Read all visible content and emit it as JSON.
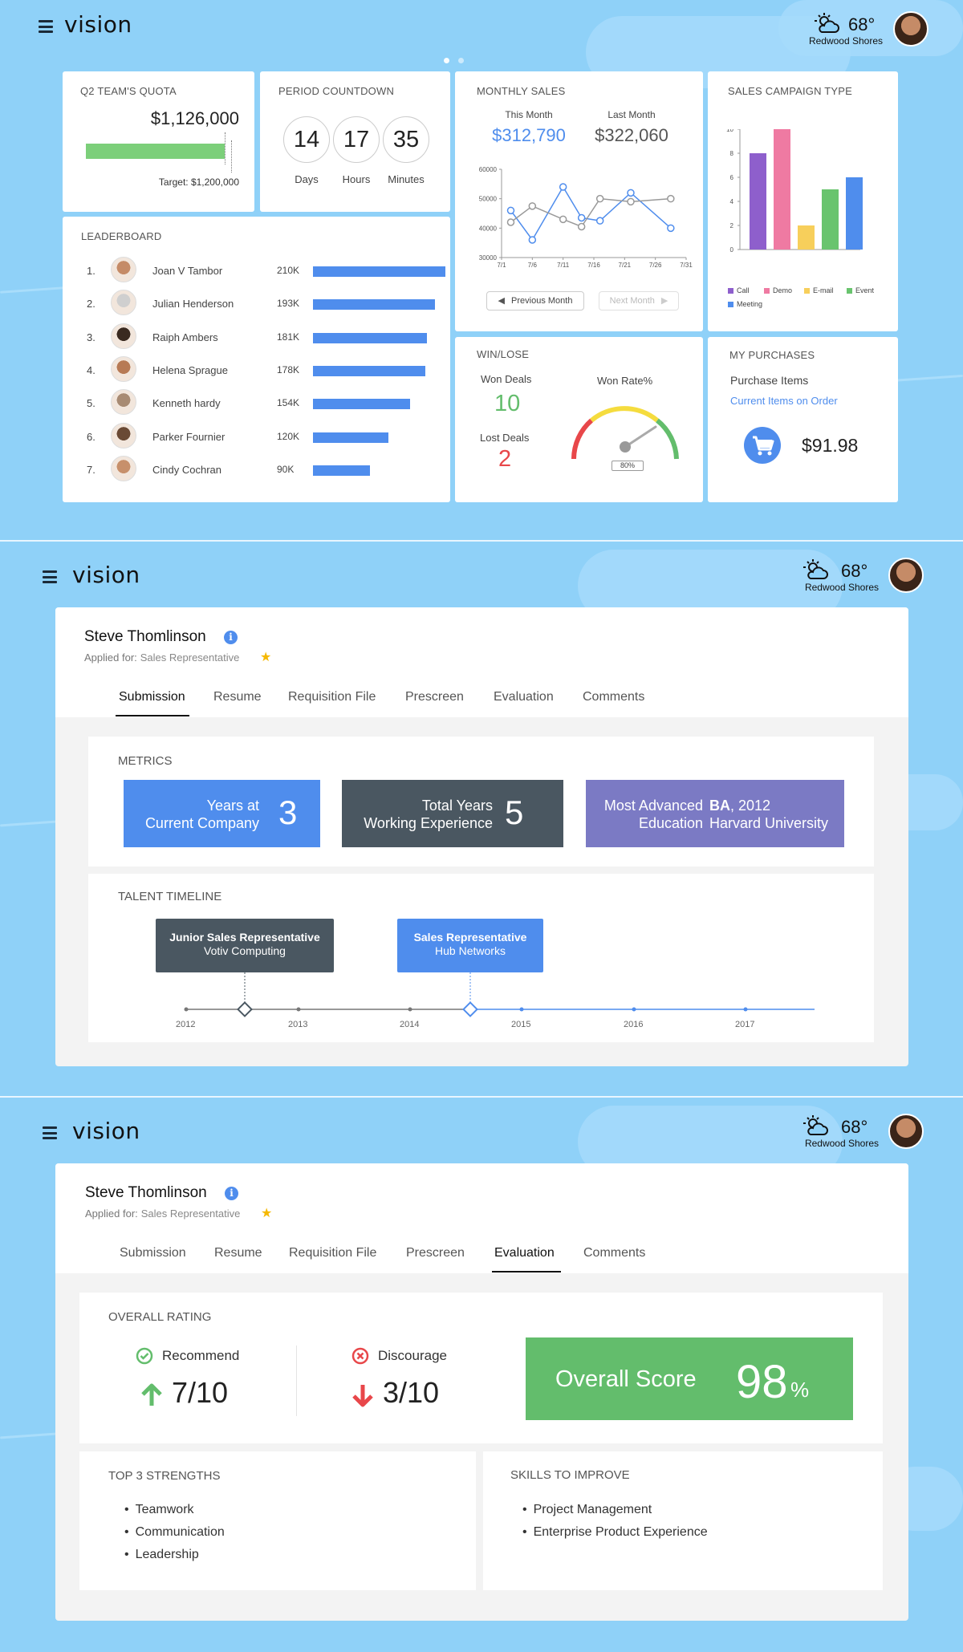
{
  "app": {
    "logo": "vision",
    "weather": {
      "temp": "68°",
      "city": "Redwood Shores",
      "icon": "partly-cloudy-icon"
    }
  },
  "dashboard": {
    "quota": {
      "title": "Q2 TEAM'S QUOTA",
      "amount": "$1,126,000",
      "target": "Target: $1,200,000",
      "progress": 0.94
    },
    "countdown": {
      "title": "PERIOD COUNTDOWN",
      "items": [
        {
          "value": "14",
          "label": "Days"
        },
        {
          "value": "17",
          "label": "Hours"
        },
        {
          "value": "35",
          "label": "Minutes"
        }
      ]
    },
    "monthly_sales": {
      "title": "MONTHLY SALES",
      "this_month_label": "This Month",
      "this_month_value": "$312,790",
      "last_month_label": "Last Month",
      "last_month_value": "$322,060",
      "prev_button": "Previous Month",
      "next_button": "Next Month"
    },
    "campaign": {
      "title": "SALES CAMPAIGN TYPE"
    },
    "leaderboard": {
      "title": "LEADERBOARD",
      "rows": [
        {
          "rank": "1.",
          "name": "Joan V Tambor",
          "value": "210K",
          "amount": 210
        },
        {
          "rank": "2.",
          "name": "Julian Henderson",
          "value": "193K",
          "amount": 193
        },
        {
          "rank": "3.",
          "name": "Raiph Ambers",
          "value": "181K",
          "amount": 181
        },
        {
          "rank": "4.",
          "name": "Helena Sprague",
          "value": "178K",
          "amount": 178
        },
        {
          "rank": "5.",
          "name": "Kenneth hardy",
          "value": "154K",
          "amount": 154
        },
        {
          "rank": "6.",
          "name": "Parker Fournier",
          "value": "120K",
          "amount": 120
        },
        {
          "rank": "7.",
          "name": "Cindy Cochran",
          "value": "90K",
          "amount": 90
        }
      ]
    },
    "winlose": {
      "title": "WIN/LOSE",
      "won_label": "Won Deals",
      "won_value": "10",
      "lost_label": "Lost Deals",
      "lost_value": "2",
      "rate_label": "Won Rate%",
      "rate_value": "80%"
    },
    "purchases": {
      "title": "MY PURCHASES",
      "items_label": "Purchase Items",
      "link": "Current Items on Order",
      "total": "$91.98"
    }
  },
  "profile": {
    "name": "Steve Thomlinson",
    "applied_label": "Applied for:",
    "applied_role": "Sales Representative",
    "tabs": [
      "Submission",
      "Resume",
      "Requisition File",
      "Prescreen",
      "Evaluation",
      "Comments"
    ]
  },
  "submission": {
    "metrics_title": "METRICS",
    "metrics": [
      {
        "line1": "Years at",
        "line2": "Current Company",
        "value": "3",
        "color": "#4f8ded"
      },
      {
        "line1": "Total Years",
        "line2": "Working Experience",
        "value": "5",
        "color": "#4a5761"
      },
      {
        "line1": "Most Advanced",
        "line2": "Education",
        "value_line1": "BA",
        "value_line1_rest": ", 2012",
        "value_line2": "Harvard University",
        "color": "#7b7ac4"
      }
    ],
    "timeline_title": "TALENT TIMELINE",
    "timeline": [
      {
        "title": "Junior Sales Representative",
        "company": "Votiv Computing",
        "color": "#4a5761"
      },
      {
        "title": "Sales Representative",
        "company": "Hub Networks",
        "color": "#4f8ded"
      }
    ],
    "years": [
      "2012",
      "2013",
      "2014",
      "2015",
      "2016",
      "2017"
    ]
  },
  "evaluation": {
    "overall_title": "OVERALL RATING",
    "recommend_label": "Recommend",
    "recommend_value": "7/10",
    "discourage_label": "Discourage",
    "discourage_value": "3/10",
    "score_label": "Overall Score",
    "score_value": "98",
    "score_unit": "%",
    "strengths_title": "TOP 3 STRENGTHS",
    "strengths": [
      "Teamwork",
      "Communication",
      "Leadership"
    ],
    "improve_title": "SKILLS TO IMPROVE",
    "improve": [
      "Project Management",
      "Enterprise Product Experience"
    ]
  },
  "chart_data": [
    {
      "type": "line",
      "title": "",
      "x": [
        "7/1",
        "7/6",
        "7/11",
        "7/16",
        "7/21",
        "7/26",
        "7/31"
      ],
      "ylim": [
        30000,
        60000
      ],
      "yticks": [
        "30000",
        "40000",
        "50000",
        "60000"
      ],
      "series": [
        {
          "name": "",
          "color": "#4f8ded",
          "x": [
            0.3,
            1,
            2,
            2.6,
            3.2,
            4.2,
            5.5
          ],
          "values": [
            46000,
            36000,
            54000,
            43500,
            42500,
            52000,
            40000
          ]
        },
        {
          "name": "",
          "color": "#999999",
          "x": [
            0.3,
            1,
            2,
            2.6,
            3.2,
            4.2,
            5.5
          ],
          "values": [
            42000,
            47500,
            43000,
            40500,
            50000,
            49000,
            50000
          ]
        }
      ]
    },
    {
      "type": "bar",
      "title": "",
      "categories": [
        "Call",
        "Demo",
        "E-mail",
        "Event",
        "Meeting"
      ],
      "values": [
        8,
        10,
        2,
        5,
        6
      ],
      "colors": [
        "#8e5fcc",
        "#ef7aa2",
        "#f7cf5b",
        "#69c46e",
        "#4f8ded"
      ],
      "ylim": [
        0,
        10
      ],
      "yticks": [
        "0",
        "2",
        "4",
        "6",
        "8",
        "10"
      ]
    }
  ]
}
